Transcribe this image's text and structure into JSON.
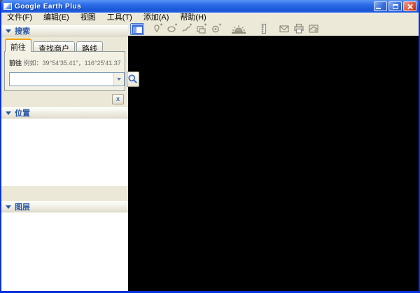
{
  "window": {
    "title": "Google Earth Plus"
  },
  "menu": {
    "items": [
      "文件(F)",
      "编辑(E)",
      "视图",
      "工具(T)",
      "添加(A)",
      "帮助(H)"
    ]
  },
  "toolbar": {
    "icons": [
      "toggle-sidebar",
      "add-placemark",
      "add-polygon",
      "add-path",
      "add-image-overlay",
      "record-tour",
      "sunlight",
      "ruler",
      "email",
      "print",
      "view-in-google-maps"
    ],
    "active_icon": "toggle-sidebar"
  },
  "sidebar": {
    "search": {
      "header": "搜索",
      "tabs": [
        "前往",
        "查找商户",
        "路线"
      ],
      "active_tab": "前往",
      "example_prefix": "前往",
      "example_text": "例如：39°54'35.41\"，116°25'41.37\"",
      "input_value": "",
      "clear_label": "x"
    },
    "places": {
      "header": "位置"
    },
    "layers": {
      "header": "图层"
    }
  },
  "colors": {
    "titlebar_blue": "#1C5AD6",
    "window_border": "#0831D9",
    "panel_bg": "#ECE8D8",
    "header_text": "#2857A8",
    "tab_accent_orange": "#EFA000",
    "search_icon_blue": "#3E6CC8",
    "viewport": "#000000"
  }
}
